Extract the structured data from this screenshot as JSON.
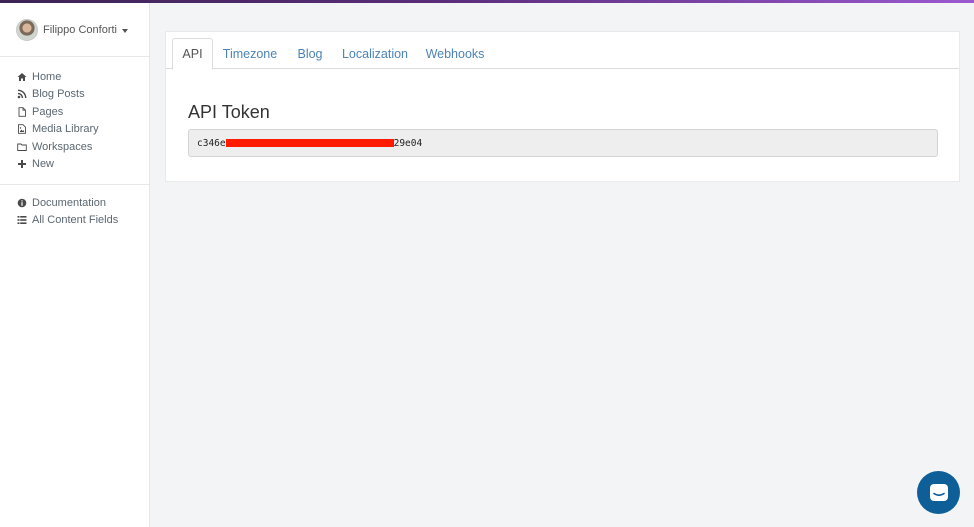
{
  "user": {
    "name": "Filippo Conforti"
  },
  "sidebar": {
    "primary": [
      {
        "label": "Home",
        "icon": "home-icon"
      },
      {
        "label": "Blog Posts",
        "icon": "rss-icon"
      },
      {
        "label": "Pages",
        "icon": "file-icon"
      },
      {
        "label": "Media Library",
        "icon": "image-file-icon"
      },
      {
        "label": "Workspaces",
        "icon": "folder-icon"
      },
      {
        "label": "New",
        "icon": "plus-icon"
      }
    ],
    "secondary": [
      {
        "label": "Documentation",
        "icon": "info-icon"
      },
      {
        "label": "All Content Fields",
        "icon": "list-icon"
      }
    ]
  },
  "tabs": [
    {
      "label": "API",
      "active": true
    },
    {
      "label": "Timezone",
      "active": false
    },
    {
      "label": "Blog",
      "active": false
    },
    {
      "label": "Localization",
      "active": false
    },
    {
      "label": "Webhooks",
      "active": false
    }
  ],
  "api": {
    "heading": "API Token",
    "token_prefix": "c346e",
    "token_suffix": "29e04"
  },
  "colors": {
    "link": "#4c84b7",
    "redaction": "#ff1a00",
    "chat_button": "#0e5f98",
    "top_bar_start": "#3d2454",
    "top_bar_end": "#9b59d0"
  },
  "chat": {
    "icon": "chat-bubble-icon"
  }
}
